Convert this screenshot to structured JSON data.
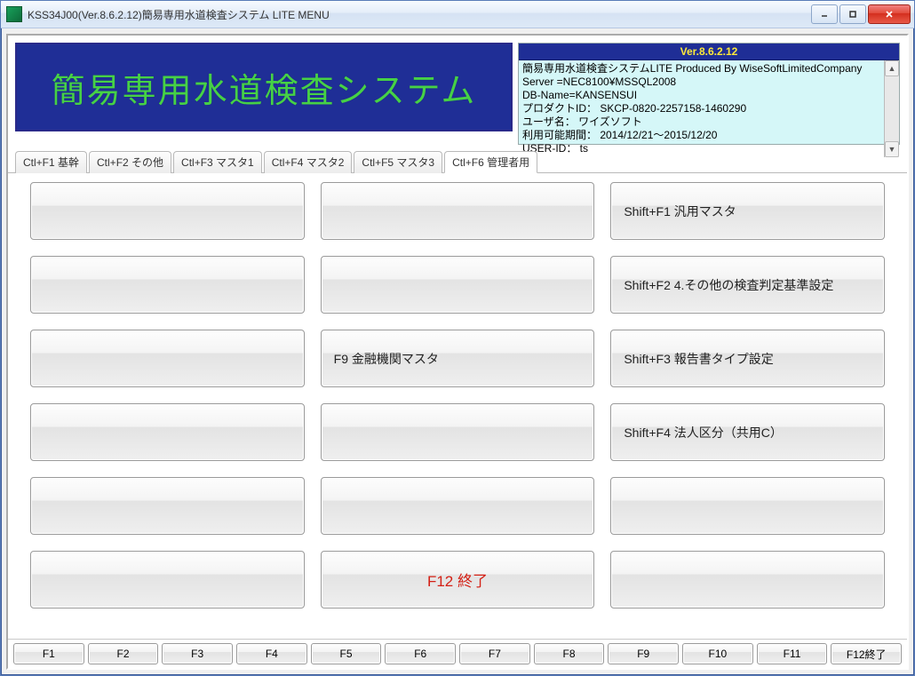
{
  "window": {
    "title": "KSS34J00(Ver.8.6.2.12)簡易専用水道検査システム LITE MENU"
  },
  "banner": {
    "title": "簡易専用水道検査システム"
  },
  "info": {
    "version_label": "Ver.8.6.2.12",
    "line1": "簡易専用水道検査システムLITE Produced By WiseSoftLimitedCompany",
    "line2": "Server =NEC8100¥MSSQL2008",
    "line3": "DB-Name=KANSENSUI",
    "line4": "プロダクトID： SKCP-0820-2257158-1460290",
    "line5": "ユーザ名： ワイズソフト",
    "line6": "利用可能期間： 2014/12/21～2015/12/20",
    "line7": "USER-ID： ts"
  },
  "tabs": [
    "Ctl+F1 基幹",
    "Ctl+F2 その他",
    "Ctl+F3 マスタ1",
    "Ctl+F4 マスタ2",
    "Ctl+F5 マスタ3",
    "Ctl+F6 管理者用"
  ],
  "grid": {
    "r1c3": "Shift+F1 汎用マスタ",
    "r2c3": "Shift+F2 4.その他の検査判定基準設定",
    "r3c2": "F9 金融機関マスタ",
    "r3c3": "Shift+F3 報告書タイプ設定",
    "r4c3": "Shift+F4 法人区分（共用C）",
    "r6c2": "F12 終了"
  },
  "fkeys": [
    "F1",
    "F2",
    "F3",
    "F4",
    "F5",
    "F6",
    "F7",
    "F8",
    "F9",
    "F10",
    "F11",
    "F12終了"
  ]
}
